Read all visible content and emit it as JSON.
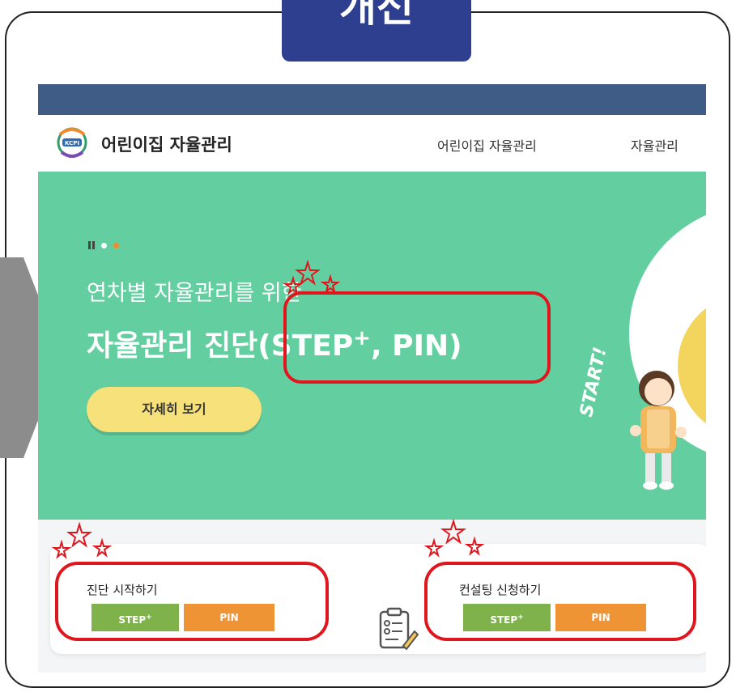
{
  "banner": {
    "title": "개선"
  },
  "header": {
    "site_title": "어린이집 자율관리",
    "logo_text": "KCPI"
  },
  "nav": {
    "items": [
      {
        "label": "어린이집 자율관리"
      },
      {
        "label": "자율관리"
      }
    ]
  },
  "hero": {
    "subtitle": "연차별 자율관리를 위한",
    "title_main": "자율관리 진단(STEP",
    "title_sup": "+",
    "title_end": ", PIN)",
    "cta_label": "자세히 보기",
    "badge_text": "START!"
  },
  "cards": {
    "diagnosis": {
      "title": "진단 시작하기",
      "step_label": "STEP",
      "step_sup": "+",
      "pin_label": "PIN"
    },
    "consulting": {
      "title": "컨설팅 신청하기",
      "step_label": "STEP",
      "step_sup": "+",
      "pin_label": "PIN"
    }
  },
  "icons": [
    "kcpi-logo-icon",
    "pause-icon",
    "document-pen-icon",
    "star-icon"
  ],
  "colors": {
    "banner": "#2f3f8f",
    "topbar": "#3e5c86",
    "hero": "#63cfa0",
    "cta": "#f7e17a",
    "step": "#7fb24a",
    "pin": "#ef9435",
    "highlight": "#e0161f"
  }
}
